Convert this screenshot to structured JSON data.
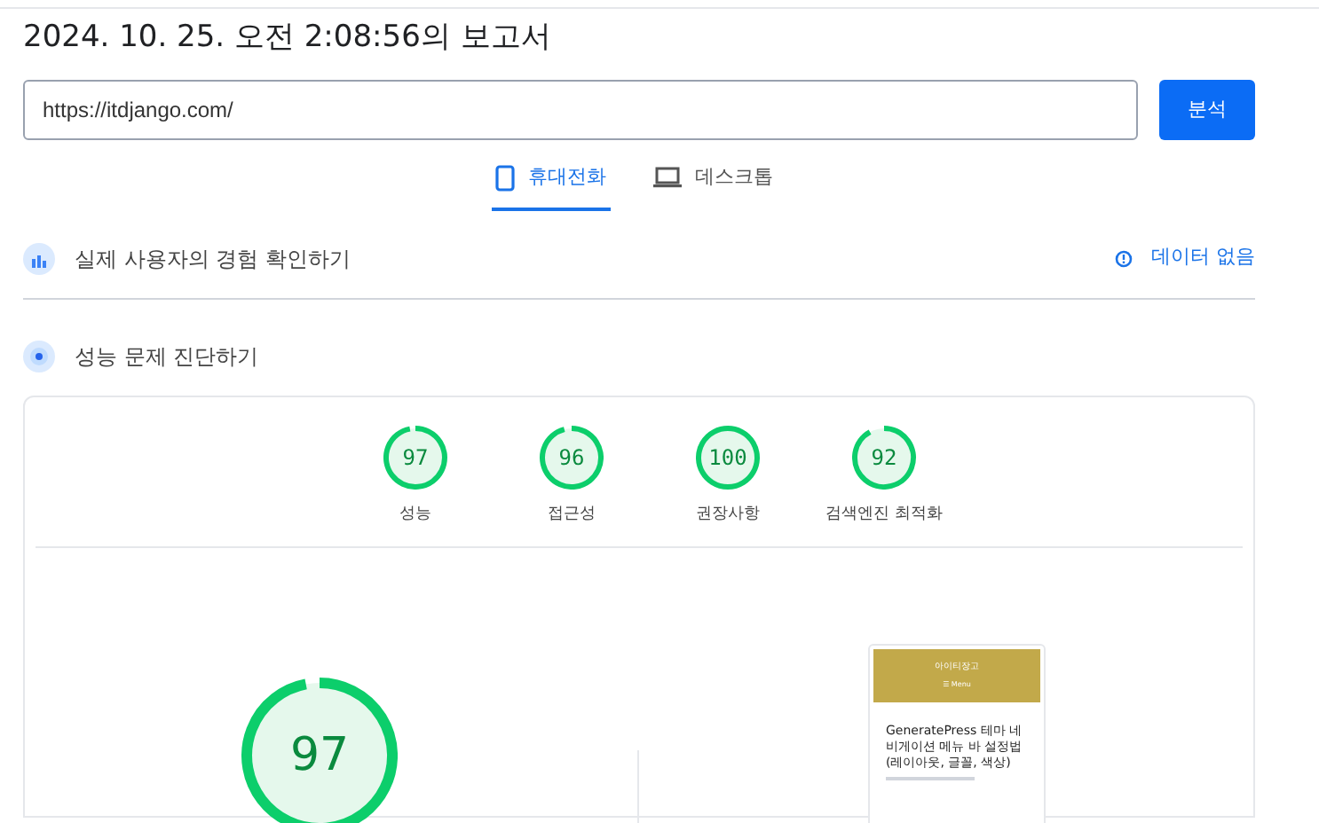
{
  "report_title": "2024. 10. 25. 오전 2:08:56의 보고서",
  "url_field": {
    "value": "https://itdjango.com/"
  },
  "analyze_button": "분석",
  "tabs": [
    {
      "label": "휴대전화",
      "kind": "mobile",
      "selected": true
    },
    {
      "label": "데스크톱",
      "kind": "desktop",
      "selected": false
    }
  ],
  "field_section": {
    "title": "실제 사용자의 경험 확인하기",
    "status": "데이터 없음"
  },
  "lab_section": {
    "title": "성능 문제 진단하기"
  },
  "category_scores": [
    {
      "score": "97",
      "label": "성능",
      "level": 0.97
    },
    {
      "score": "96",
      "label": "접근성",
      "level": 0.96
    },
    {
      "score": "100",
      "label": "권장사항",
      "level": 1.0
    },
    {
      "score": "92",
      "label": "검색엔진 최적화",
      "level": 0.92
    }
  ],
  "main_score": {
    "score": "97",
    "level": 0.97
  },
  "page_preview": {
    "site_name": "아이티장고",
    "menu": "☰ Menu",
    "post_title": "GeneratePress 테마 네비게이션 메뉴 바 설정법(레이아웃, 글꼴, 색상)"
  }
}
